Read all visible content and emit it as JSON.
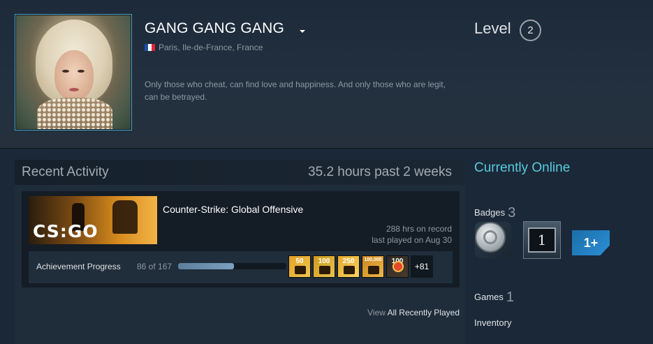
{
  "profile": {
    "persona_name": "GANG GANG GANG",
    "location": "Paris, Ile-de-France, France",
    "flag_colors": [
      "#1f4fa8",
      "#ffffff",
      "#e0243b"
    ],
    "summary": "Only those who cheat, can find love and happiness. And only those who are legit, can be betrayed.",
    "level_label": "Level",
    "level": "2"
  },
  "activity": {
    "title": "Recent Activity",
    "hours_past_2_weeks": "35.2 hours past 2 weeks",
    "game": {
      "name": "Counter-Strike: Global Offensive",
      "capsule_logo": "CS:GO",
      "hours_on_record": "288 hrs on record",
      "last_played": "last played on Aug 30",
      "achievement_label": "Achievement Progress",
      "achievement_count": "86 of 167",
      "achievement_progress": 0.515,
      "achievement_icons": [
        {
          "name": "achievement-icon-1",
          "label": "50"
        },
        {
          "name": "achievement-icon-2",
          "label": "100"
        },
        {
          "name": "achievement-icon-3",
          "label": "250"
        },
        {
          "name": "achievement-icon-4",
          "label": "100,000"
        },
        {
          "name": "achievement-icon-5",
          "label": "100"
        }
      ],
      "more_achievements": "+81"
    },
    "view_prefix": "View",
    "view_link": "All Recently Played"
  },
  "sidebar": {
    "online_status": "Currently Online",
    "online_color": "#57cbde",
    "badges_label": "Badges",
    "badges_count": "3",
    "badge_icons": [
      "coin-badge-icon",
      "one-badge-icon",
      "years-of-service-icon"
    ],
    "badge_one_text": "1",
    "badge_years_text": "1+",
    "games_label": "Games",
    "games_count": "1",
    "inventory_label": "Inventory"
  }
}
